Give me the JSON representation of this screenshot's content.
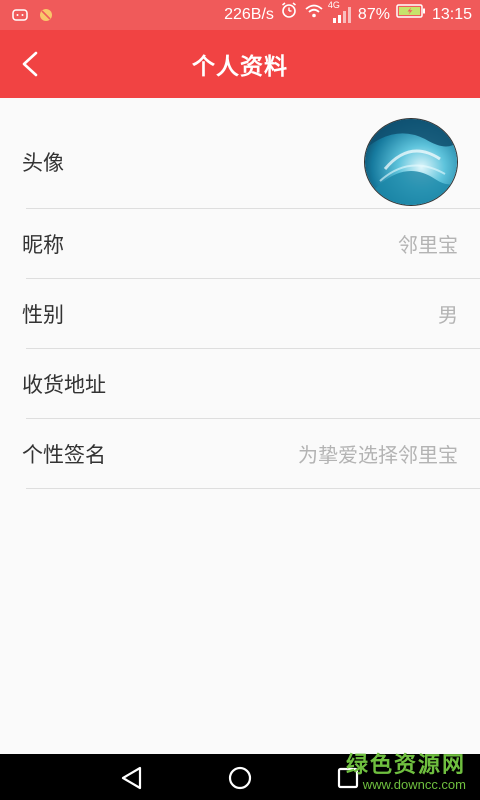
{
  "status_bar": {
    "speed": "226B/s",
    "network": "4G",
    "battery": "87%",
    "time": "13:15",
    "icons": [
      "android-icon",
      "no-disturb-icon",
      "alarm-icon",
      "wifi-icon",
      "signal-icon",
      "battery-icon"
    ]
  },
  "header": {
    "title": "个人资料",
    "back_icon": "chevron-left-icon"
  },
  "profile": {
    "rows": [
      {
        "label": "头像",
        "value": ""
      },
      {
        "label": "昵称",
        "value": "邻里宝"
      },
      {
        "label": "性别",
        "value": "男"
      },
      {
        "label": "收货地址",
        "value": ""
      },
      {
        "label": "个性签名",
        "value": "为挚爱选择邻里宝"
      }
    ]
  },
  "nav": {
    "icons": [
      "back-triangle-icon",
      "home-circle-icon",
      "recents-square-icon"
    ]
  },
  "watermark": {
    "main": "绿色资源网",
    "sub": "www.downcc.com"
  },
  "colors": {
    "header_bg": "#f14343",
    "status_bg": "#f05a5a",
    "label_text": "#333333",
    "value_text": "#b3b3b3"
  }
}
